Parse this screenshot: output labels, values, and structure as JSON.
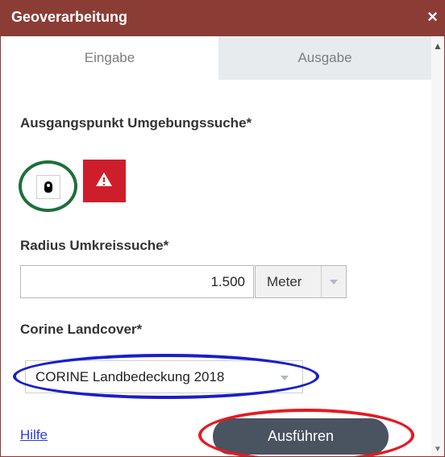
{
  "window": {
    "title": "Geoverarbeitung",
    "close_icon": "×"
  },
  "tabs": [
    {
      "label": "Eingabe",
      "active": true
    },
    {
      "label": "Ausgabe",
      "active": false
    }
  ],
  "start_point": {
    "label": "Ausgangspunkt Umgebungssuche*"
  },
  "radius": {
    "label": "Radius Umkreissuche*",
    "value": "1.500",
    "unit": "Meter"
  },
  "corine": {
    "label": "Corine Landcover*",
    "selected": "CORINE Landbedeckung 2018"
  },
  "footer": {
    "help_label": "Hilfe",
    "run_label": "Ausführen"
  },
  "colors": {
    "titlebar": "#8b3d35",
    "warning": "#cf1e2b",
    "run_button": "#4a5360",
    "highlight_green": "#1e6f3a",
    "highlight_blue": "#1a1fc9",
    "highlight_red": "#e31b23"
  }
}
